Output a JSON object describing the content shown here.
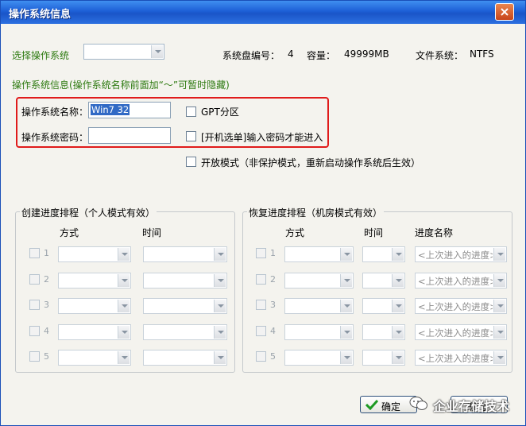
{
  "window": {
    "title": "操作系统信息"
  },
  "top": {
    "select_os_label": "选择操作系统",
    "select_os_value": "",
    "disk_no_label": "系统盘编号：",
    "disk_no_value": "4",
    "capacity_label": "容量：",
    "capacity_value": "49999MB",
    "fs_label": "文件系统：",
    "fs_value": "NTFS"
  },
  "os_info": {
    "section_title": "操作系统信息(操作系统名称前面加“～”可暂时隐藏)",
    "name_label": "操作系统名称：",
    "name_value": "Win7 32",
    "password_label": "操作系统密码：",
    "password_value": "",
    "gpt_label": "GPT分区",
    "boot_menu_label": "[开机选单]输入密码才能进入",
    "open_mode_label": "开放模式（非保护模式，重新启动操作系统后生效）"
  },
  "create_group": {
    "title": "创建进度排程（个人模式有效）",
    "col_mode": "方式",
    "col_time": "时间",
    "rows": [
      "1",
      "2",
      "3",
      "4",
      "5"
    ]
  },
  "restore_group": {
    "title": "恢复进度排程（机房模式有效）",
    "col_mode": "方式",
    "col_time": "时间",
    "col_name": "进度名称",
    "rows": [
      "1",
      "2",
      "3",
      "4",
      "5"
    ],
    "name_placeholder": "<上次进入的进度>"
  },
  "buttons": {
    "ok_label": "确定",
    "cancel_label": "取消"
  },
  "watermark": {
    "text": "企业存储技术"
  }
}
